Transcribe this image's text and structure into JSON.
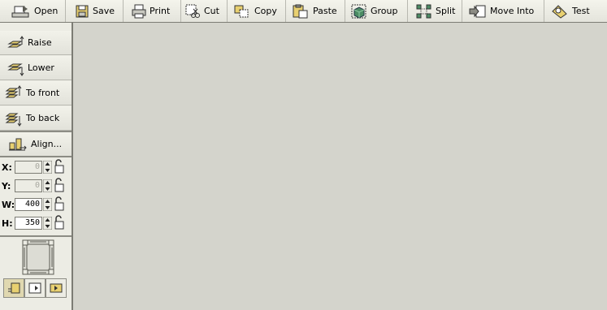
{
  "toolbar": {
    "open": "Open",
    "save": "Save",
    "print": "Print",
    "cut": "Cut",
    "copy": "Copy",
    "paste": "Paste",
    "group": "Group",
    "split": "Split",
    "move_into": "Move Into",
    "test": "Test"
  },
  "sidebar": {
    "raise": "Raise",
    "lower": "Lower",
    "to_front": "To front",
    "to_back": "To back",
    "align": "Align..."
  },
  "fields": {
    "x": {
      "label": "X:",
      "value": "0",
      "disabled": true
    },
    "y": {
      "label": "Y:",
      "value": "0",
      "disabled": true
    },
    "w": {
      "label": "W:",
      "value": "400",
      "disabled": false
    },
    "h": {
      "label": "H:",
      "value": "350",
      "disabled": false
    }
  },
  "colors": {
    "canvas": "#d4d4cc",
    "panel": "#ecece4",
    "icon_yellow": "#e8d070",
    "icon_green": "#4c8c64"
  }
}
